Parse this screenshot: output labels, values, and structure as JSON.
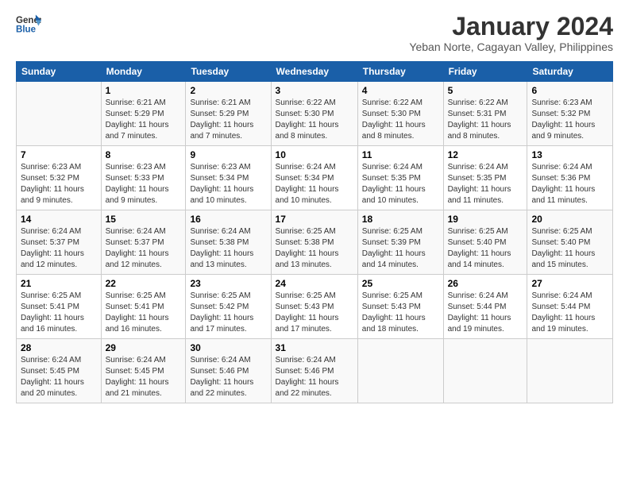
{
  "logo": {
    "line1": "General",
    "line2": "Blue"
  },
  "title": "January 2024",
  "subtitle": "Yeban Norte, Cagayan Valley, Philippines",
  "headers": [
    "Sunday",
    "Monday",
    "Tuesday",
    "Wednesday",
    "Thursday",
    "Friday",
    "Saturday"
  ],
  "weeks": [
    [
      {
        "day": "",
        "info": ""
      },
      {
        "day": "1",
        "info": "Sunrise: 6:21 AM\nSunset: 5:29 PM\nDaylight: 11 hours\nand 7 minutes."
      },
      {
        "day": "2",
        "info": "Sunrise: 6:21 AM\nSunset: 5:29 PM\nDaylight: 11 hours\nand 7 minutes."
      },
      {
        "day": "3",
        "info": "Sunrise: 6:22 AM\nSunset: 5:30 PM\nDaylight: 11 hours\nand 8 minutes."
      },
      {
        "day": "4",
        "info": "Sunrise: 6:22 AM\nSunset: 5:30 PM\nDaylight: 11 hours\nand 8 minutes."
      },
      {
        "day": "5",
        "info": "Sunrise: 6:22 AM\nSunset: 5:31 PM\nDaylight: 11 hours\nand 8 minutes."
      },
      {
        "day": "6",
        "info": "Sunrise: 6:23 AM\nSunset: 5:32 PM\nDaylight: 11 hours\nand 9 minutes."
      }
    ],
    [
      {
        "day": "7",
        "info": "Sunrise: 6:23 AM\nSunset: 5:32 PM\nDaylight: 11 hours\nand 9 minutes."
      },
      {
        "day": "8",
        "info": "Sunrise: 6:23 AM\nSunset: 5:33 PM\nDaylight: 11 hours\nand 9 minutes."
      },
      {
        "day": "9",
        "info": "Sunrise: 6:23 AM\nSunset: 5:34 PM\nDaylight: 11 hours\nand 10 minutes."
      },
      {
        "day": "10",
        "info": "Sunrise: 6:24 AM\nSunset: 5:34 PM\nDaylight: 11 hours\nand 10 minutes."
      },
      {
        "day": "11",
        "info": "Sunrise: 6:24 AM\nSunset: 5:35 PM\nDaylight: 11 hours\nand 10 minutes."
      },
      {
        "day": "12",
        "info": "Sunrise: 6:24 AM\nSunset: 5:35 PM\nDaylight: 11 hours\nand 11 minutes."
      },
      {
        "day": "13",
        "info": "Sunrise: 6:24 AM\nSunset: 5:36 PM\nDaylight: 11 hours\nand 11 minutes."
      }
    ],
    [
      {
        "day": "14",
        "info": "Sunrise: 6:24 AM\nSunset: 5:37 PM\nDaylight: 11 hours\nand 12 minutes."
      },
      {
        "day": "15",
        "info": "Sunrise: 6:24 AM\nSunset: 5:37 PM\nDaylight: 11 hours\nand 12 minutes."
      },
      {
        "day": "16",
        "info": "Sunrise: 6:24 AM\nSunset: 5:38 PM\nDaylight: 11 hours\nand 13 minutes."
      },
      {
        "day": "17",
        "info": "Sunrise: 6:25 AM\nSunset: 5:38 PM\nDaylight: 11 hours\nand 13 minutes."
      },
      {
        "day": "18",
        "info": "Sunrise: 6:25 AM\nSunset: 5:39 PM\nDaylight: 11 hours\nand 14 minutes."
      },
      {
        "day": "19",
        "info": "Sunrise: 6:25 AM\nSunset: 5:40 PM\nDaylight: 11 hours\nand 14 minutes."
      },
      {
        "day": "20",
        "info": "Sunrise: 6:25 AM\nSunset: 5:40 PM\nDaylight: 11 hours\nand 15 minutes."
      }
    ],
    [
      {
        "day": "21",
        "info": "Sunrise: 6:25 AM\nSunset: 5:41 PM\nDaylight: 11 hours\nand 16 minutes."
      },
      {
        "day": "22",
        "info": "Sunrise: 6:25 AM\nSunset: 5:41 PM\nDaylight: 11 hours\nand 16 minutes."
      },
      {
        "day": "23",
        "info": "Sunrise: 6:25 AM\nSunset: 5:42 PM\nDaylight: 11 hours\nand 17 minutes."
      },
      {
        "day": "24",
        "info": "Sunrise: 6:25 AM\nSunset: 5:43 PM\nDaylight: 11 hours\nand 17 minutes."
      },
      {
        "day": "25",
        "info": "Sunrise: 6:25 AM\nSunset: 5:43 PM\nDaylight: 11 hours\nand 18 minutes."
      },
      {
        "day": "26",
        "info": "Sunrise: 6:24 AM\nSunset: 5:44 PM\nDaylight: 11 hours\nand 19 minutes."
      },
      {
        "day": "27",
        "info": "Sunrise: 6:24 AM\nSunset: 5:44 PM\nDaylight: 11 hours\nand 19 minutes."
      }
    ],
    [
      {
        "day": "28",
        "info": "Sunrise: 6:24 AM\nSunset: 5:45 PM\nDaylight: 11 hours\nand 20 minutes."
      },
      {
        "day": "29",
        "info": "Sunrise: 6:24 AM\nSunset: 5:45 PM\nDaylight: 11 hours\nand 21 minutes."
      },
      {
        "day": "30",
        "info": "Sunrise: 6:24 AM\nSunset: 5:46 PM\nDaylight: 11 hours\nand 22 minutes."
      },
      {
        "day": "31",
        "info": "Sunrise: 6:24 AM\nSunset: 5:46 PM\nDaylight: 11 hours\nand 22 minutes."
      },
      {
        "day": "",
        "info": ""
      },
      {
        "day": "",
        "info": ""
      },
      {
        "day": "",
        "info": ""
      }
    ]
  ]
}
